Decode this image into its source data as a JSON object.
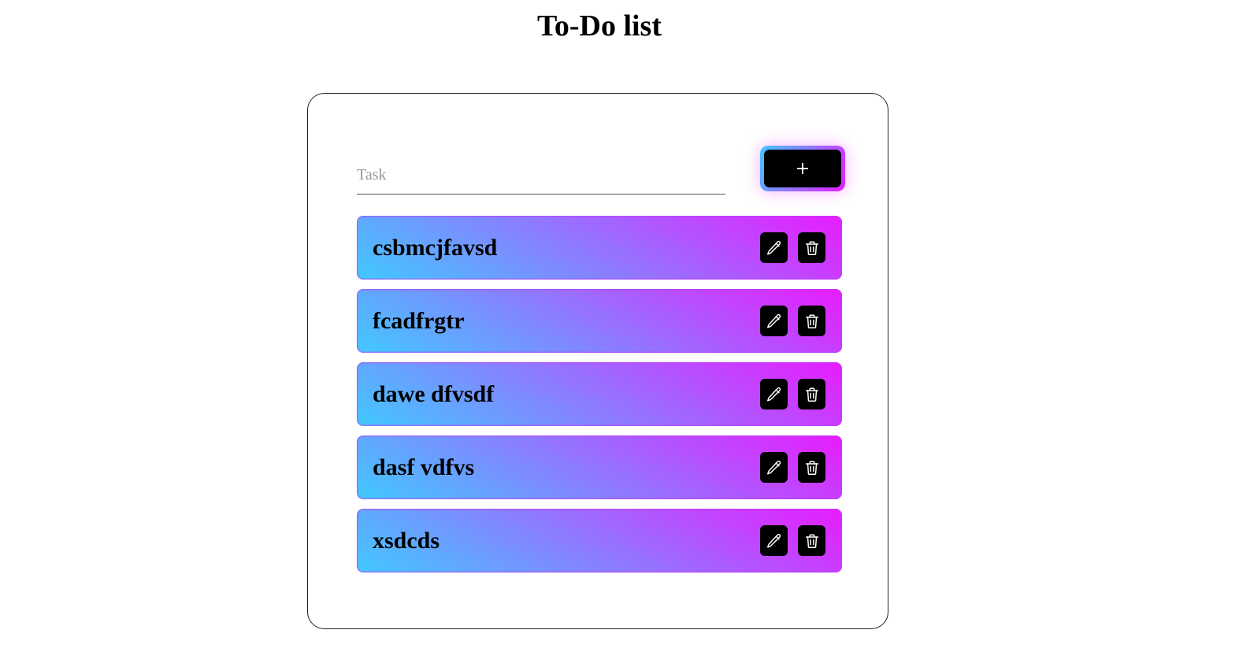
{
  "page": {
    "title": "To-Do list"
  },
  "form": {
    "task_placeholder": "Task",
    "task_value": "",
    "add_label": "+"
  },
  "tasks": [
    {
      "text": "csbmcjfavsd"
    },
    {
      "text": "fcadfrgtr"
    },
    {
      "text": "dawe dfvsdf"
    },
    {
      "text": "dasf vdfvs"
    },
    {
      "text": "xsdcds"
    }
  ],
  "icons": {
    "edit": "pencil-icon",
    "delete": "trash-icon"
  },
  "colors": {
    "gradient_start": "#40c9ff",
    "gradient_end": "#e81cff",
    "button_bg": "#000000",
    "border": "#222222"
  }
}
